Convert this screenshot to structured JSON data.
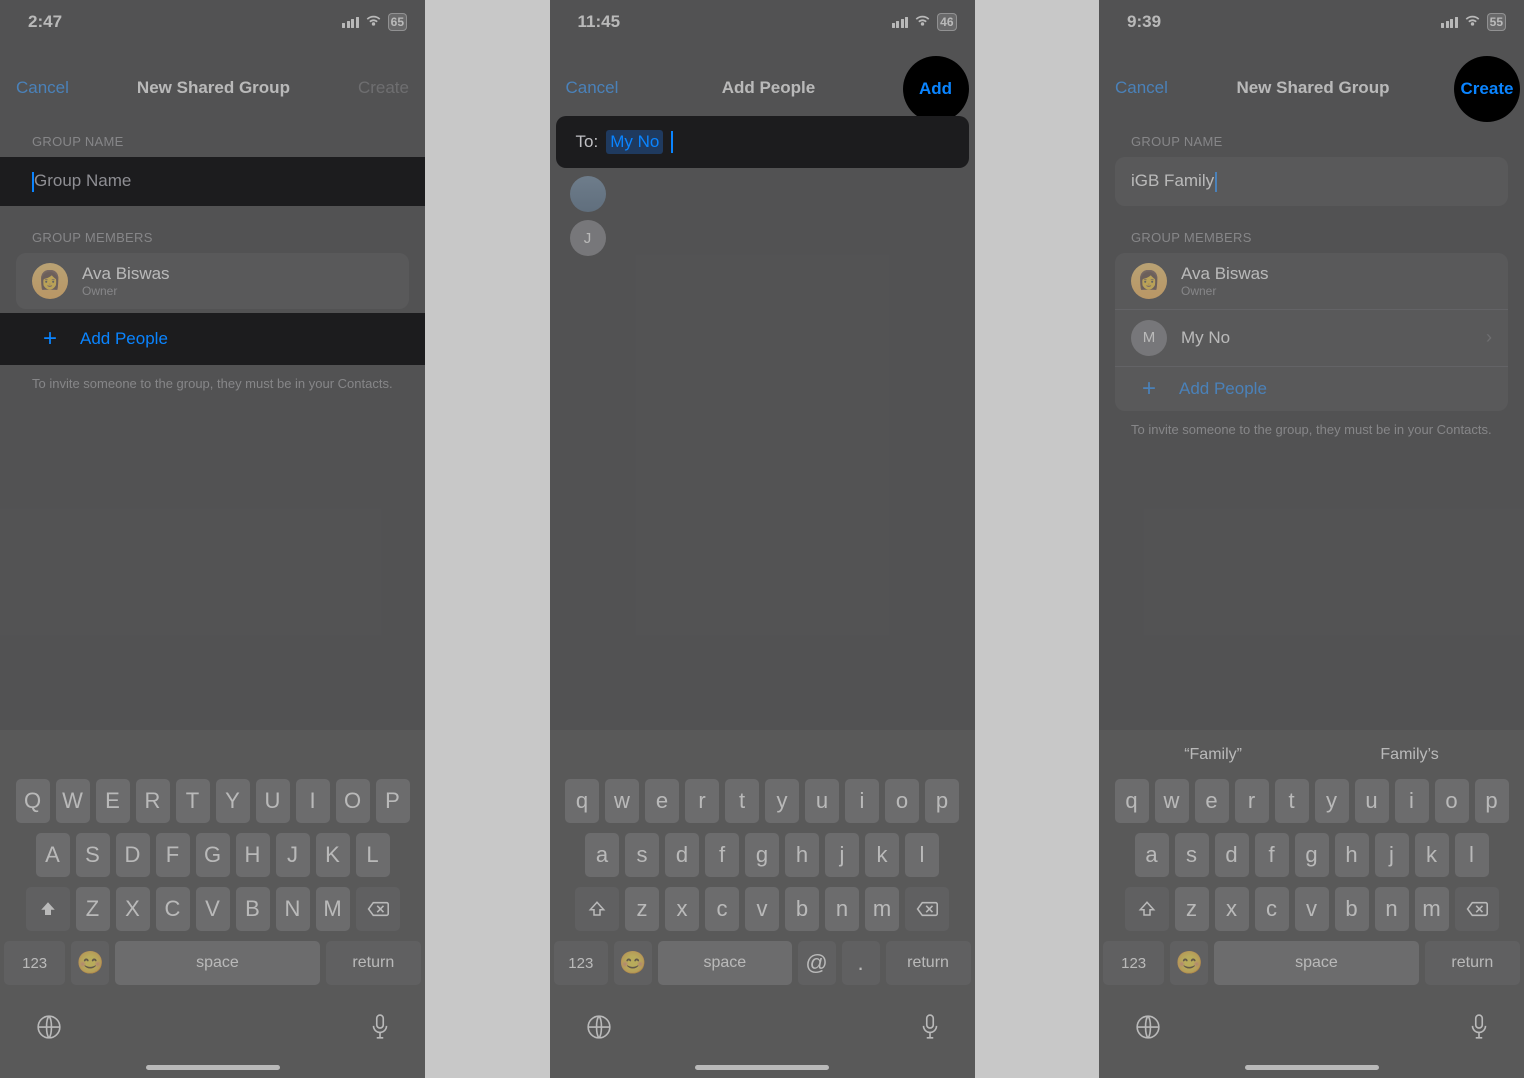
{
  "phones": {
    "p1": {
      "status": {
        "time": "2:47",
        "battery": "65"
      },
      "nav": {
        "cancel": "Cancel",
        "title": "New Shared Group",
        "create": "Create"
      },
      "groupNameLabel": "GROUP NAME",
      "groupNamePlaceholder": "Group Name",
      "groupMembersLabel": "GROUP MEMBERS",
      "owner": {
        "name": "Ava Biswas",
        "role": "Owner"
      },
      "addPeople": "Add People",
      "hint": "To invite someone to the group, they must be in your Contacts."
    },
    "p2": {
      "status": {
        "time": "11:45",
        "battery": "46"
      },
      "nav": {
        "cancel": "Cancel",
        "title": "Add People",
        "add": "Add"
      },
      "toLabel": "To:",
      "toValue": "My No",
      "contacts": [
        {
          "type": "photo"
        },
        {
          "type": "letter",
          "initial": "J"
        }
      ]
    },
    "p3": {
      "status": {
        "time": "9:39",
        "battery": "55"
      },
      "nav": {
        "cancel": "Cancel",
        "title": "New Shared Group",
        "create": "Create"
      },
      "groupNameLabel": "GROUP NAME",
      "groupNameValue": "iGB Family",
      "groupMembersLabel": "GROUP MEMBERS",
      "owner": {
        "name": "Ava Biswas",
        "role": "Owner"
      },
      "member": {
        "name": "My No",
        "initial": "M"
      },
      "addPeople": "Add People",
      "hint": "To invite someone to the group, they must be in your Contacts.",
      "suggestions": [
        "“Family”",
        "Family’s"
      ]
    }
  },
  "keyboard": {
    "upperRow1": [
      "Q",
      "W",
      "E",
      "R",
      "T",
      "Y",
      "U",
      "I",
      "O",
      "P"
    ],
    "upperRow2": [
      "A",
      "S",
      "D",
      "F",
      "G",
      "H",
      "J",
      "K",
      "L"
    ],
    "upperRow3": [
      "Z",
      "X",
      "C",
      "V",
      "B",
      "N",
      "M"
    ],
    "lowerRow1": [
      "q",
      "w",
      "e",
      "r",
      "t",
      "y",
      "u",
      "i",
      "o",
      "p"
    ],
    "lowerRow2": [
      "a",
      "s",
      "d",
      "f",
      "g",
      "h",
      "j",
      "k",
      "l"
    ],
    "lowerRow3": [
      "z",
      "x",
      "c",
      "v",
      "b",
      "n",
      "m"
    ],
    "numKey": "123",
    "spaceKey": "space",
    "returnKey": "return",
    "atKey": "@",
    "dotKey": "."
  }
}
